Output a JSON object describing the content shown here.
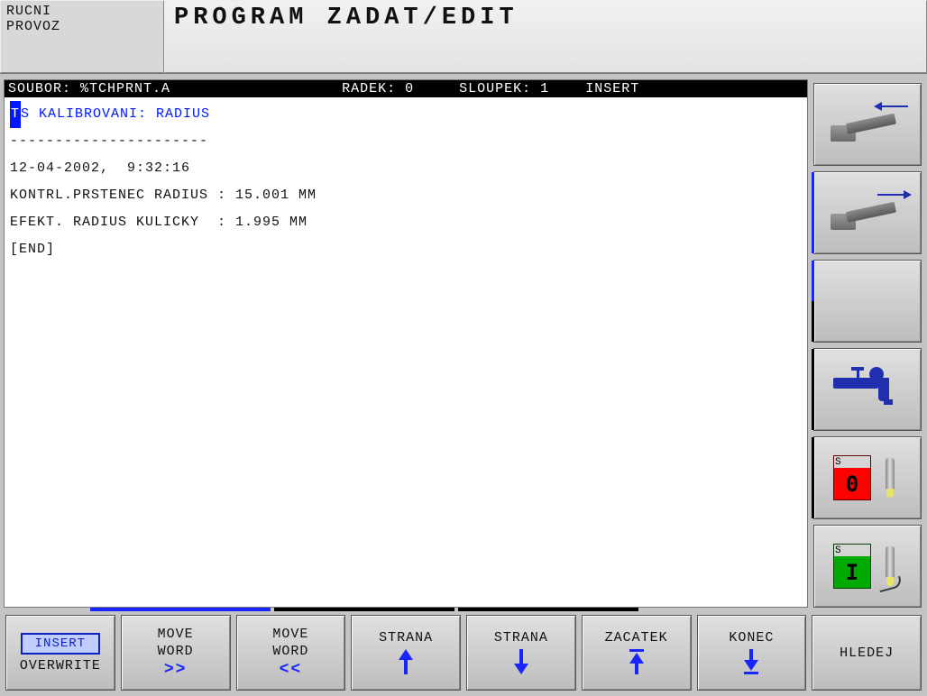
{
  "header": {
    "mode_line1": "RUCNI",
    "mode_line2": "PROVOZ",
    "title": "PROGRAM ZADAT/EDIT"
  },
  "status": {
    "file_label": "SOUBOR:",
    "file_name": "%TCHPRNT.A",
    "row_label": "RADEK:",
    "row_value": "0",
    "col_label": "SLOUPEK:",
    "col_value": "1",
    "mode": "INSERT"
  },
  "editor": {
    "cursor_char": "T",
    "line1_rest": "S KALIBROVANI: RADIUS",
    "separator": "----------------------",
    "timestamp": "12-04-2002,  9:32:16",
    "line_ring": "KONTRL.PRSTENEC RADIUS : 15.001 MM",
    "line_ball": "EFEKT. RADIUS KULICKY  : 1.995 MM",
    "end_marker": "[END]"
  },
  "sidebar": {
    "s0_label": "S",
    "s0_value": "0",
    "s1_label": "S",
    "s1_value": "I"
  },
  "softkeys": {
    "insert": "INSERT",
    "overwrite": "OVERWRITE",
    "move_word": "MOVE",
    "move_word2": "WORD",
    "fwd": ">>",
    "back": "<<",
    "strana": "STRANA",
    "zacatek": "ZACATEK",
    "konec": "KONEC",
    "hledej": "HLEDEJ"
  }
}
